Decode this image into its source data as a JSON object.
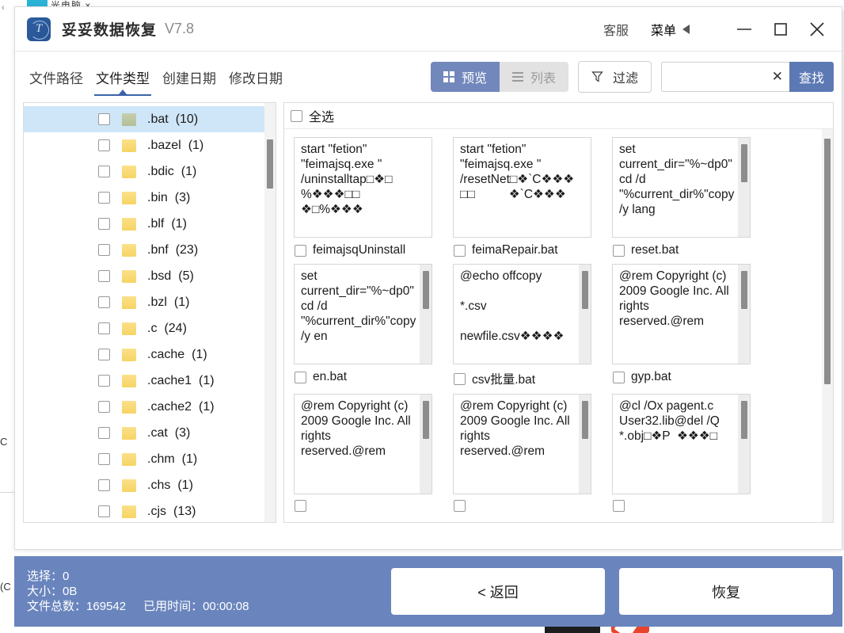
{
  "desktop": {
    "browser_tab_text": "光电脑 ×",
    "left_glyph_1": "C",
    "left_glyph_2": "(C"
  },
  "titlebar": {
    "logo_text": "T",
    "app_name": "妥妥数据恢复",
    "version": "V7.8",
    "support_label": "客服",
    "menu_label": "菜单",
    "minimize_label": "minimize",
    "maximize_label": "maximize",
    "close_label": "close"
  },
  "toolbar": {
    "tabs": [
      {
        "label": "文件路径",
        "active": false
      },
      {
        "label": "文件类型",
        "active": true
      },
      {
        "label": "创建日期",
        "active": false
      },
      {
        "label": "修改日期",
        "active": false
      }
    ],
    "preview_label": "预览",
    "list_label": "列表",
    "filter_label": "过滤",
    "search_value": "",
    "search_placeholder": "",
    "clear_label": "✕",
    "find_label": "查找"
  },
  "left_pane": {
    "types": [
      {
        "name": ".bat",
        "count": "(10)",
        "selected": true,
        "folder": "green"
      },
      {
        "name": ".bazel",
        "count": "(1)",
        "selected": false,
        "folder": "yellow"
      },
      {
        "name": ".bdic",
        "count": "(1)",
        "selected": false,
        "folder": "yellow"
      },
      {
        "name": ".bin",
        "count": "(3)",
        "selected": false,
        "folder": "yellow"
      },
      {
        "name": ".blf",
        "count": "(1)",
        "selected": false,
        "folder": "yellow"
      },
      {
        "name": ".bnf",
        "count": "(23)",
        "selected": false,
        "folder": "yellow"
      },
      {
        "name": ".bsd",
        "count": "(5)",
        "selected": false,
        "folder": "yellow"
      },
      {
        "name": ".bzl",
        "count": "(1)",
        "selected": false,
        "folder": "yellow"
      },
      {
        "name": ".c",
        "count": "(24)",
        "selected": false,
        "folder": "yellow"
      },
      {
        "name": ".cache",
        "count": "(1)",
        "selected": false,
        "folder": "yellow"
      },
      {
        "name": ".cache1",
        "count": "(1)",
        "selected": false,
        "folder": "yellow"
      },
      {
        "name": ".cache2",
        "count": "(1)",
        "selected": false,
        "folder": "yellow"
      },
      {
        "name": ".cat",
        "count": "(3)",
        "selected": false,
        "folder": "yellow"
      },
      {
        "name": ".chm",
        "count": "(1)",
        "selected": false,
        "folder": "yellow"
      },
      {
        "name": ".chs",
        "count": "(1)",
        "selected": false,
        "folder": "yellow"
      },
      {
        "name": ".cjs",
        "count": "(13)",
        "selected": false,
        "folder": "yellow"
      }
    ]
  },
  "right_pane": {
    "select_all_label": "全选",
    "files": [
      {
        "preview": "start \"fetion\" \"feimajsq.exe \" /uninstalltap□❖□ %❖❖❖□□ ❖□%❖❖❖",
        "name": "feimajsqUninstall",
        "scroll": false
      },
      {
        "preview": "start \"fetion\" \"feimajsq.exe \" /resetNet□❖`C❖❖❖ □□          ❖`C❖❖❖",
        "name": "feimaRepair.bat",
        "scroll": false
      },
      {
        "preview": "set current_dir=\"%~dp0\"cd /d \"%current_dir%\"copy /y lang",
        "name": "reset.bat",
        "scroll": true
      },
      {
        "preview": "set current_dir=\"%~dp0\"cd /d \"%current_dir%\"copy /y en",
        "name": "en.bat",
        "scroll": true
      },
      {
        "preview": "@echo offcopy\n\n*.csv\n\nnewfile.csv❖❖❖❖",
        "name": "csv批量.bat",
        "scroll": true
      },
      {
        "preview": "@rem Copyright (c) 2009 Google Inc. All rights reserved.@rem",
        "name": "gyp.bat",
        "scroll": true
      },
      {
        "preview": "@rem Copyright (c) 2009 Google Inc. All rights reserved.@rem",
        "name": "",
        "scroll": true
      },
      {
        "preview": "@rem Copyright (c) 2009 Google Inc. All rights reserved.@rem",
        "name": "",
        "scroll": true
      },
      {
        "preview": "@cl /Ox pagent.c User32.lib@del /Q\n*.obj□❖P  ❖❖❖□",
        "name": "",
        "scroll": true
      }
    ]
  },
  "footer": {
    "selected_label": "选择：",
    "selected_value": "0",
    "size_label": "大小：",
    "size_value": "0B",
    "total_label": "文件总数：",
    "total_value": "169542",
    "elapsed_label": "已用时间：",
    "elapsed_value": "00:00:08",
    "back_label": "< 返回",
    "recover_label": "恢复"
  },
  "colors": {
    "accent_blue": "#5d79b4",
    "footer_blue": "#6a85bd",
    "seg_active": "#7287bb",
    "row_selected": "#cfe6f8",
    "tab_underline": "#3b63a8"
  }
}
